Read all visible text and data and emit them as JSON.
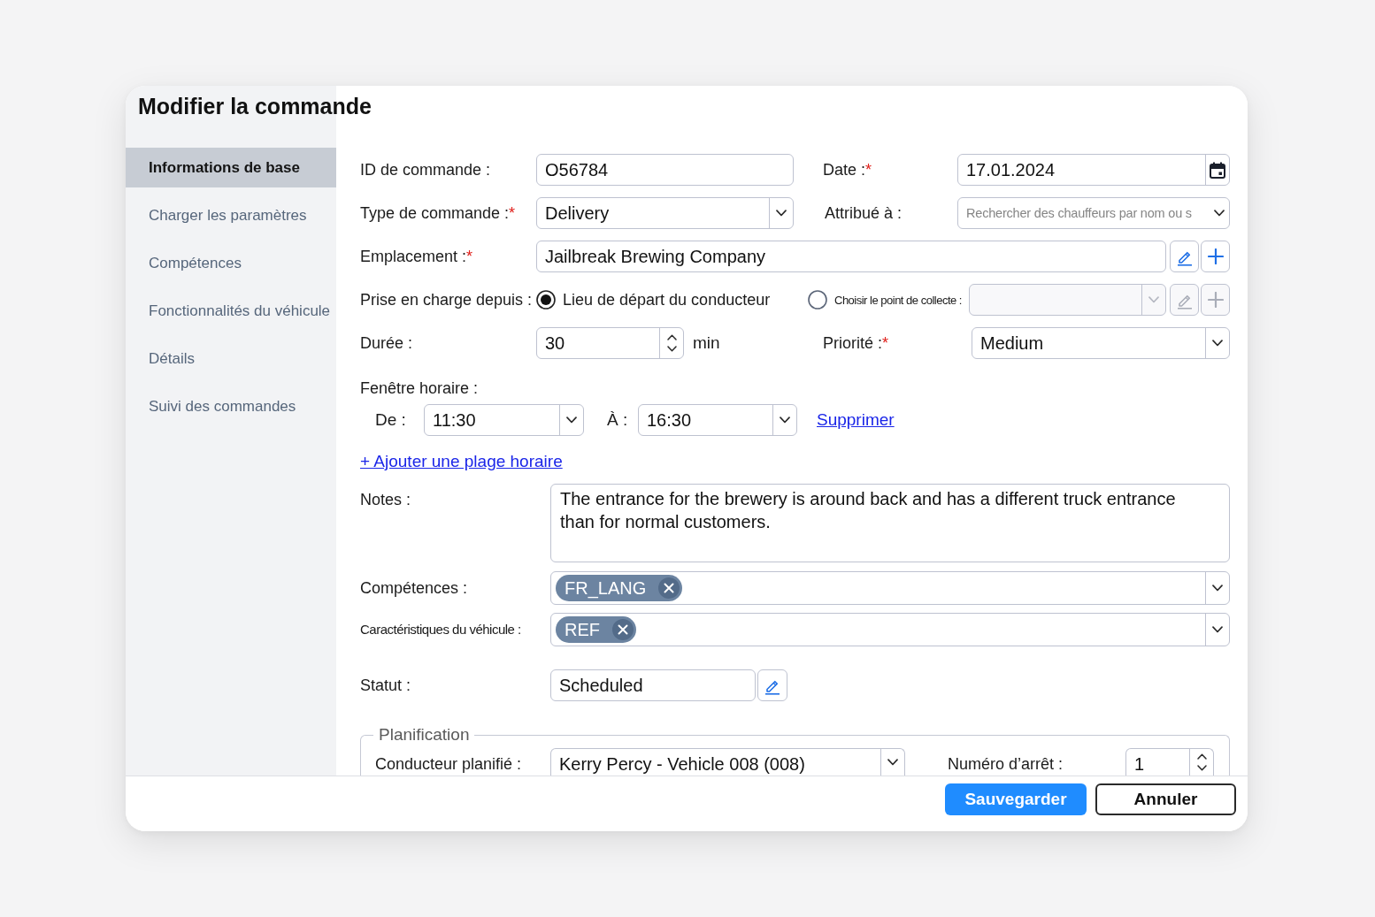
{
  "dialog": {
    "title": "Modifier la commande"
  },
  "sidebar": {
    "items": [
      {
        "label": "Informations de base",
        "selected": true
      },
      {
        "label": "Charger les paramètres",
        "selected": false
      },
      {
        "label": "Compétences",
        "selected": false
      },
      {
        "label": "Fonctionnalités du véhicule",
        "selected": false
      },
      {
        "label": "Détails",
        "selected": false
      },
      {
        "label": "Suivi des commandes",
        "selected": false
      }
    ]
  },
  "form": {
    "order_id": {
      "label": "ID de commande :",
      "value": "O56784"
    },
    "date": {
      "label": "Date :",
      "required_mark": "*",
      "value": "17.01.2024"
    },
    "order_type": {
      "label": "Type de commande :",
      "required_mark": "*",
      "value": "Delivery"
    },
    "assigned_to": {
      "label": "Attribué à :",
      "placeholder": "Rechercher des chauffeurs par nom ou s"
    },
    "location": {
      "label": "Emplacement :",
      "required_mark": "*",
      "value": "Jailbreak Brewing Company"
    },
    "pickup": {
      "label": "Prise en charge depuis :",
      "options": [
        {
          "label": "Lieu de départ du conducteur",
          "selected": true
        },
        {
          "label": "Choisir le point de collecte :",
          "selected": false
        }
      ]
    },
    "collection_point": {
      "disabled": true
    },
    "duration": {
      "label": "Durée :",
      "value": "30",
      "unit": "min"
    },
    "priority": {
      "label": "Priorité :",
      "required_mark": "*",
      "value": "Medium"
    },
    "time_window": {
      "label": "Fenêtre horaire :",
      "from_label": "De :",
      "from": "11:30",
      "to_label": "À :",
      "to": "16:30",
      "remove_link": "Supprimer"
    },
    "add_time_window_link": "+ Ajouter une plage horaire",
    "notes": {
      "label": "Notes :",
      "value": "The entrance for the brewery is around back and has a different truck entrance than for normal customers."
    },
    "skills": {
      "label": "Compétences :",
      "tags": [
        "FR_LANG"
      ]
    },
    "vehicle_features": {
      "label": "Caractéristiques du véhicule :",
      "tags": [
        "REF"
      ]
    },
    "status": {
      "label": "Statut :",
      "value": "Scheduled"
    }
  },
  "planification": {
    "legend": "Planification",
    "driver": {
      "label": "Conducteur planifié :",
      "value": "Kerry Percy - Vehicle 008 (008)"
    },
    "stop_number": {
      "label": "Numéro d’arrêt :",
      "value": "1"
    }
  },
  "footer": {
    "buttons": [
      {
        "label": "Sauvegarder",
        "kind": "primary"
      },
      {
        "label": "Annuler",
        "kind": "secondary"
      }
    ]
  }
}
